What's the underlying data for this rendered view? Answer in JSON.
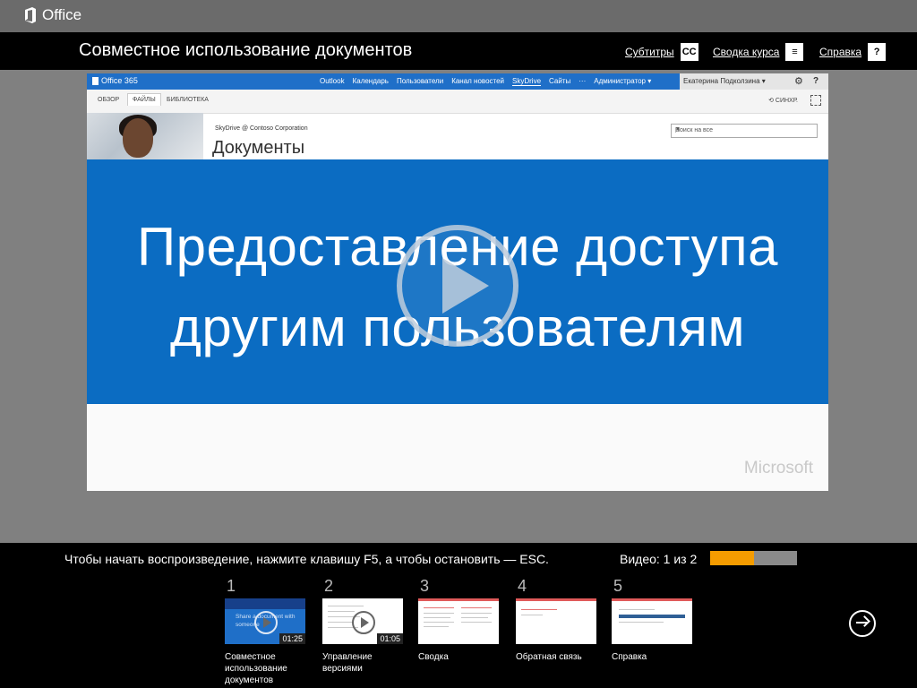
{
  "app": {
    "brand": "Office"
  },
  "header": {
    "title": "Совместное использование документов",
    "links": [
      {
        "label": "Субтитры",
        "icon": "cc-icon",
        "glyph": "CC"
      },
      {
        "label": "Сводка курса",
        "icon": "summary-icon",
        "glyph": "≡"
      },
      {
        "label": "Справка",
        "icon": "help-icon",
        "glyph": "?"
      }
    ]
  },
  "video": {
    "o365_brand": "Office 365",
    "nav": [
      "Outlook",
      "Календарь",
      "Пользователи",
      "Канал новостей",
      "SkyDrive",
      "Сайты",
      "···",
      "Администратор ▾"
    ],
    "user": "Екатерина Подколзина ▾",
    "ribbon_tabs": [
      "ОБЗОР",
      "ФАЙЛЫ",
      "БИБЛИОТЕКА"
    ],
    "sync_label": "СИНХР.",
    "site_crumb": "SkyDrive @ Contoso Corporation",
    "docs_title": "Документы",
    "search_placeholder": "Поиск на все",
    "headline_line1": "Предоставление доступа",
    "headline_line2": "другим пользователям",
    "watermark": "Microsoft"
  },
  "player": {
    "hint": "Чтобы начать воспроизведение, нажмите клавишу F5, а чтобы остановить — ESC.",
    "video_counter": "Видео: 1 из 2",
    "progress_fraction": 0.5,
    "accent_color": "#f59c00"
  },
  "chapters": [
    {
      "num": "1",
      "caption": "Совместное использование документов",
      "duration": "01:25",
      "thumb_text": "Share a document with someone"
    },
    {
      "num": "2",
      "caption": "Управление версиями",
      "duration": "01:05"
    },
    {
      "num": "3",
      "caption": "Сводка"
    },
    {
      "num": "4",
      "caption": "Обратная связь"
    },
    {
      "num": "5",
      "caption": "Справка"
    }
  ]
}
